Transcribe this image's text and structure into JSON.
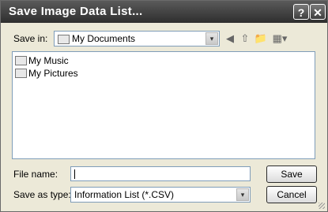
{
  "dialog": {
    "title": "Save Image Data List..."
  },
  "titlebar": {
    "help": "?",
    "close": "✕"
  },
  "location": {
    "label": "Save in:",
    "value": "My Documents"
  },
  "toolbar": {
    "back_glyph": "◀",
    "up_glyph": "⇧",
    "newfolder_glyph": "📁",
    "views_glyph": "▦▾"
  },
  "files": [
    {
      "name": "My Music"
    },
    {
      "name": "My Pictures"
    }
  ],
  "filename": {
    "label": "File name:",
    "value": ""
  },
  "filetype": {
    "label": "Save as type:",
    "value": "Information List (*.CSV)"
  },
  "buttons": {
    "save": "Save",
    "cancel": "Cancel"
  },
  "icons": {
    "dropdown": "▾"
  }
}
